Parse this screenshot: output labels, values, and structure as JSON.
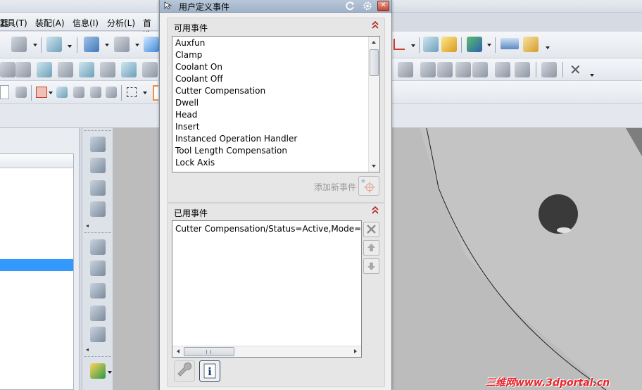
{
  "menu": [
    "工具(T)",
    "装配(A)",
    "信息(I)",
    "分析(L)",
    "首选"
  ],
  "menu_partial_left": "器",
  "dialog": {
    "title": "用户定义事件",
    "available": {
      "header": "可用事件",
      "items": [
        "Auxfun",
        "Clamp",
        "Coolant On",
        "Coolant Off",
        "Cutter Compensation",
        "Dwell",
        "Head",
        "Insert",
        "Instanced Operation Handler",
        "Tool Length Compensation",
        "Lock Axis"
      ]
    },
    "add_new_label": "添加新事件",
    "used": {
      "header": "已用事件",
      "items": [
        "Cutter Compensation/Status=Active,Mode=Le"
      ]
    }
  },
  "watermark": "三维网www.3dportal.cn",
  "colors": {
    "title_bar": "#a9bbd0",
    "selection": "#3399ff",
    "close_button": "#c7442f",
    "collapse_chevron": "#b0261c",
    "watermark": "#e8232a"
  }
}
